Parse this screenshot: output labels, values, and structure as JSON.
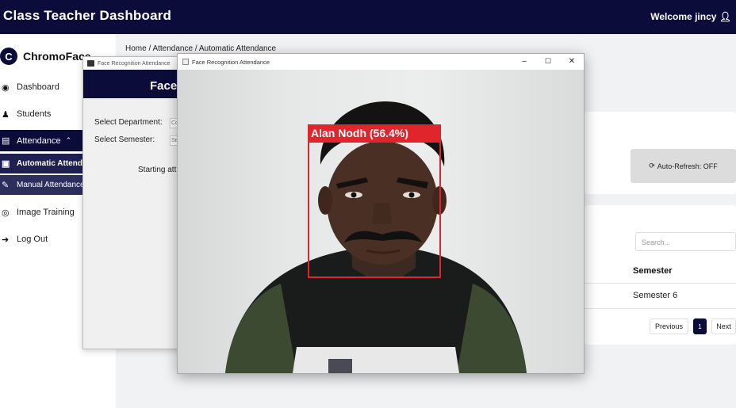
{
  "header": {
    "title": "Class Teacher Dashboard",
    "welcome": "Welcome jincy"
  },
  "sidebar": {
    "brand": "ChromoFace",
    "items": [
      {
        "label": "Dashboard",
        "icon": "dashboard-icon"
      },
      {
        "label": "Students",
        "icon": "students-icon"
      },
      {
        "label": "Attendance",
        "icon": "attendance-icon",
        "expanded_icon": "chevron-up-icon"
      },
      {
        "label": "Automatic Attendance",
        "icon": "robot-icon"
      },
      {
        "label": "Manual Attendance",
        "icon": "edit-icon"
      },
      {
        "label": "Image Training",
        "icon": "camera-icon"
      },
      {
        "label": "Log Out",
        "icon": "logout-icon"
      }
    ]
  },
  "breadcrumb": "Home / Attendance / Automatic Attendance",
  "main": {
    "refresh_label": "Auto-Refresh: OFF",
    "search_placeholder": "Search...",
    "table": {
      "header": "Semester",
      "rows": [
        "Semester 6"
      ]
    },
    "pagination": {
      "prev": "Previous",
      "page": "1",
      "next": "Next"
    }
  },
  "back_window": {
    "title": "Face Recognition Attendance",
    "banner": "Face",
    "dept_label": "Select Department:",
    "dept_value": "Co",
    "sem_label": "Select Semester:",
    "sem_value": "Se",
    "status": "Starting att"
  },
  "front_window": {
    "title": "Face Recognition Attendance",
    "minimize": "–",
    "maximize": "☐",
    "close": "✕",
    "detection_label": "Alan Nodh (56.4%)"
  },
  "colors": {
    "navy": "#0b0c3a",
    "box": "#e0262c"
  }
}
